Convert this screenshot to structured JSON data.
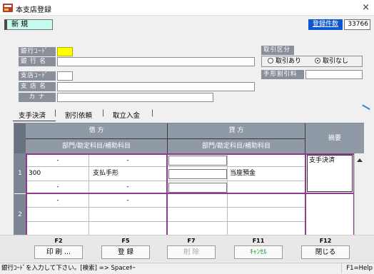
{
  "window": {
    "title": "本支店登録",
    "close": "×"
  },
  "header": {
    "mode": "新 規",
    "count_label": "登録件数",
    "count_value": "33766"
  },
  "form": {
    "bank_code_label": "銀行ｺｰﾄﾞ",
    "bank_name_label": "銀 行 名",
    "branch_code_label": "支店ｺｰﾄﾞ",
    "branch_name_label": "支 店 名",
    "kana_label": "カ ナ",
    "transaction_label": "取引区分",
    "transaction_options": [
      "取引あり",
      "取引なし"
    ],
    "transaction_selected": "取引なし",
    "discount_rate_label": "手形割引料"
  },
  "tabs": [
    "支手決済",
    "割引依頼",
    "取立入金"
  ],
  "grid": {
    "debit_header": "借 方",
    "credit_header": "貸 方",
    "debit_sub": "部門/勘定科目/補助科目",
    "credit_sub": "部門/勘定科目/補助科目",
    "summary_header": "摘要",
    "rows": [
      {
        "num": "1",
        "debit_dept": "-",
        "debit_sub": "-",
        "debit_dept2": "300",
        "debit_account": "支払手形",
        "debit_dept3": "-",
        "debit_sub3": "-",
        "credit_account": "当座預金",
        "summary": "支手決済"
      },
      {
        "num": "2",
        "debit_dept": "-",
        "debit_sub": "-"
      }
    ]
  },
  "fkeys": [
    {
      "key": "F2",
      "label": "印 刷 ..."
    },
    {
      "key": "F5",
      "label": "登 録"
    },
    {
      "key": "F7",
      "label": "削 除"
    },
    {
      "key": "F11",
      "label": "ｷｬﾝｾﾙ"
    },
    {
      "key": "F12",
      "label": "閉じる"
    }
  ],
  "status": {
    "message": "銀行ｺｰﾄﾞを入力して下さい。[検索] => Spaceｷｰ",
    "help": "F1=Help"
  }
}
